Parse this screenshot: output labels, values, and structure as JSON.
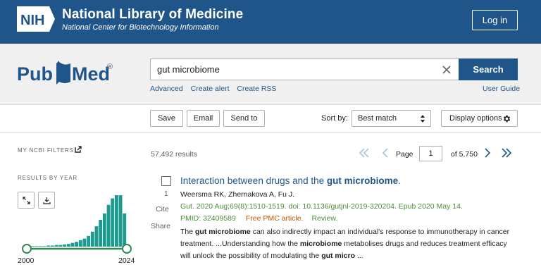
{
  "header": {
    "nih_logo": "NIH",
    "title": "National Library of Medicine",
    "subtitle": "National Center for Biotechnology Information",
    "login_label": "Log in",
    "brand_color": "#20558a"
  },
  "search": {
    "logo": "PubMed",
    "logo_mark": "®",
    "query": "gut microbiome",
    "button_label": "Search",
    "links": [
      "Advanced",
      "Create alert",
      "Create RSS"
    ],
    "user_guide": "User Guide"
  },
  "toolbar": {
    "save_label": "Save",
    "email_label": "Email",
    "send_to_label": "Send to",
    "sort_label": "Sort by:",
    "sort_value": "Best match",
    "display_options_label": "Display options"
  },
  "sidebar": {
    "filters_label": "MY NCBI FILTERS",
    "results_by_year_label": "RESULTS BY YEAR",
    "year_start": "2000",
    "year_end": "2024"
  },
  "results_meta": {
    "count_text": "57,492 results",
    "page_label": "Page",
    "current_page": "1",
    "of_pages": "of 5,750"
  },
  "result": {
    "number": "1",
    "cite_label": "Cite",
    "share_label": "Share",
    "title_prefix": "Interaction between drugs and the ",
    "title_bold": "gut microbiome",
    "title_suffix": ".",
    "authors": "Weersma RK, Zhernakova A, Fu J.",
    "citation": "Gut. 2020 Aug;69(8):1510-1519. doi: 10.1136/gutjnl-2019-320204. Epub 2020 May 14.",
    "pmid": "PMID: 32409589",
    "free_pmc": "Free PMC article.",
    "review": "Review.",
    "snippet": [
      {
        "t": "The ",
        "b": false
      },
      {
        "t": "gut microbiome",
        "b": true
      },
      {
        "t": " can also indirectly impact an individual's response to immunotherapy in cancer treatment. ...Understanding how the ",
        "b": false
      },
      {
        "t": "microbiome",
        "b": true
      },
      {
        "t": " metabolises drugs and reduces treatment efficacy will unlock the possibility of modulating the ",
        "b": false
      },
      {
        "t": "gut micro",
        "b": true
      },
      {
        "t": " ...",
        "b": false
      }
    ]
  },
  "chart_data": {
    "type": "bar",
    "categories": [
      "2000",
      "2001",
      "2002",
      "2003",
      "2004",
      "2005",
      "2006",
      "2007",
      "2008",
      "2009",
      "2010",
      "2011",
      "2012",
      "2013",
      "2014",
      "2015",
      "2016",
      "2017",
      "2018",
      "2019",
      "2020",
      "2021",
      "2022",
      "2023",
      "2024"
    ],
    "values": [
      1,
      1,
      1,
      1,
      1,
      2,
      2,
      3,
      3,
      4,
      5,
      7,
      9,
      12,
      15,
      20,
      28,
      38,
      50,
      62,
      78,
      90,
      96,
      96,
      62
    ],
    "title": "",
    "xlabel": "",
    "ylabel": "",
    "ylim": [
      0,
      100
    ],
    "bar_color": "#1f9a8e",
    "slider_color": "#2e8b57"
  }
}
